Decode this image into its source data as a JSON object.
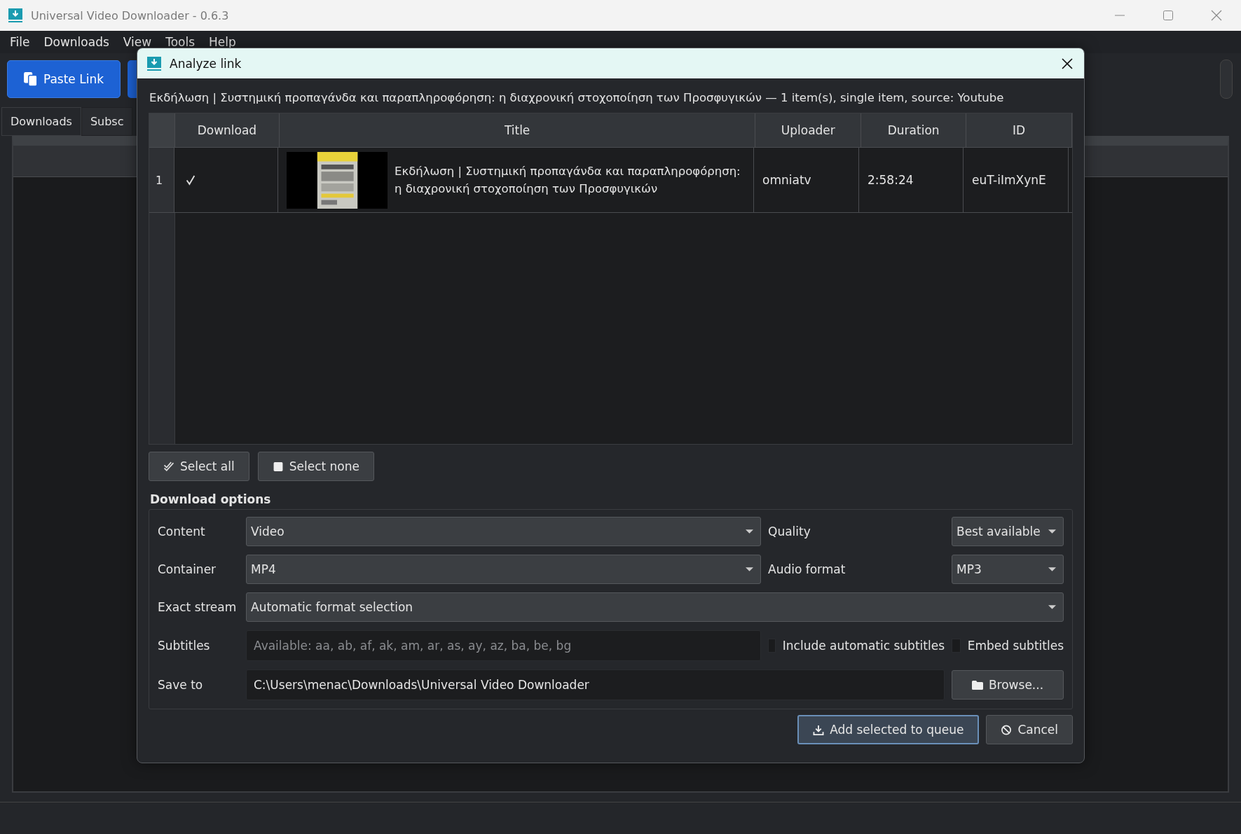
{
  "window": {
    "title": "Universal Video Downloader - 0.6.3"
  },
  "menu": [
    "File",
    "Downloads",
    "View",
    "Tools",
    "Help"
  ],
  "toolbar": [
    {
      "label": "Paste Link"
    }
  ],
  "tabs": [
    {
      "label": "Downloads",
      "selected": true
    },
    {
      "label": "Subsc",
      "selected": false
    }
  ],
  "dialog": {
    "title": "Analyze link",
    "summary": "Εκδήλωση | Συστημική προπαγάνδα και παραπληροφόρηση: η διαχρονική στοχοποίηση των Προσφυγικών — 1 item(s), single item, source: Youtube",
    "table": {
      "columns": [
        "Download",
        "Title",
        "Uploader",
        "Duration",
        "ID"
      ],
      "rows": [
        {
          "number": "1",
          "checked": true,
          "title": "Εκδήλωση | Συστημική προπαγάνδα και παραπληροφόρηση: η διαχρονική στοχοποίηση των Προσφυγικών",
          "uploader": "omniatv",
          "duration": "2:58:24",
          "id": "euT-iImXynE"
        }
      ]
    },
    "selection_buttons": [
      {
        "label": "Select all",
        "kind": "all"
      },
      {
        "label": "Select none",
        "kind": "none"
      }
    ],
    "options": {
      "title": "Download options",
      "content": {
        "label": "Content",
        "value": "Video"
      },
      "quality": {
        "label": "Quality",
        "value": "Best available"
      },
      "container": {
        "label": "Container",
        "value": "MP4"
      },
      "audio_format": {
        "label": "Audio format",
        "value": "MP3"
      },
      "exact_stream": {
        "label": "Exact stream",
        "value": "Automatic format selection"
      },
      "subtitles": {
        "label": "Subtitles",
        "placeholder": "Available: aa, ab, af, ak, am, ar, as, ay, az, ba, be, bg"
      },
      "include_automatic_subtitles": {
        "label": "Include automatic subtitles",
        "checked": false
      },
      "embed_subtitles": {
        "label": "Embed subtitles",
        "checked": false
      },
      "save_to": {
        "label": "Save to",
        "value": "C:\\Users\\menac\\Downloads\\Universal Video Downloader"
      },
      "browse": "Browse..."
    },
    "buttons": [
      {
        "label": "Add selected to queue",
        "kind": "add"
      },
      {
        "label": "Cancel",
        "kind": "cancel"
      }
    ]
  }
}
